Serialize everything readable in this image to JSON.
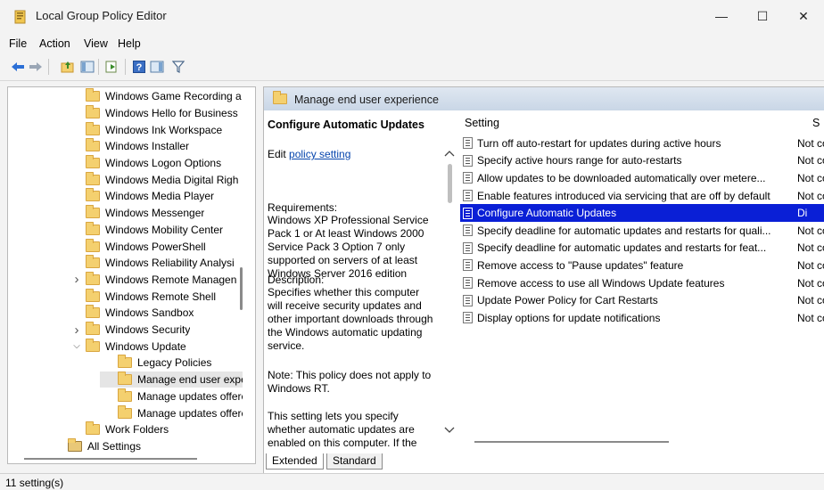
{
  "window": {
    "title": "Local Group Policy Editor",
    "minimize_glyph": "—",
    "maximize_glyph": "☐",
    "close_glyph": "✕"
  },
  "menu": [
    "File",
    "Action",
    "View",
    "Help"
  ],
  "toolbar": {
    "icons": [
      "back-arrow-icon",
      "forward-arrow-icon",
      "up-folder-icon",
      "show-hide-tree-icon",
      "export-list-icon",
      "help-icon",
      "show-hide-action-pane-icon",
      "filter-icon"
    ]
  },
  "tree": {
    "items": [
      {
        "label": "Windows Game Recording a",
        "indent": 1,
        "expander": ""
      },
      {
        "label": "Windows Hello for Business",
        "indent": 1,
        "expander": ""
      },
      {
        "label": "Windows Ink Workspace",
        "indent": 1,
        "expander": ""
      },
      {
        "label": "Windows Installer",
        "indent": 1,
        "expander": ""
      },
      {
        "label": "Windows Logon Options",
        "indent": 1,
        "expander": ""
      },
      {
        "label": "Windows Media Digital Righ",
        "indent": 1,
        "expander": ""
      },
      {
        "label": "Windows Media Player",
        "indent": 1,
        "expander": ""
      },
      {
        "label": "Windows Messenger",
        "indent": 1,
        "expander": ""
      },
      {
        "label": "Windows Mobility Center",
        "indent": 1,
        "expander": ""
      },
      {
        "label": "Windows PowerShell",
        "indent": 1,
        "expander": ""
      },
      {
        "label": "Windows Reliability Analysi",
        "indent": 1,
        "expander": ""
      },
      {
        "label": "Windows Remote Managen",
        "indent": 1,
        "expander": ">"
      },
      {
        "label": "Windows Remote Shell",
        "indent": 1,
        "expander": ""
      },
      {
        "label": "Windows Sandbox",
        "indent": 1,
        "expander": ""
      },
      {
        "label": "Windows Security",
        "indent": 1,
        "expander": ">"
      },
      {
        "label": "Windows Update",
        "indent": 1,
        "expander": "v"
      },
      {
        "label": "Legacy Policies",
        "indent": 2,
        "expander": ""
      },
      {
        "label": "Manage end user experi",
        "indent": 2,
        "expander": "",
        "selected": true
      },
      {
        "label": "Manage updates offerec",
        "indent": 2,
        "expander": ""
      },
      {
        "label": "Manage updates offerec",
        "indent": 2,
        "expander": ""
      },
      {
        "label": "Work Folders",
        "indent": 1,
        "expander": ""
      },
      {
        "label": "All Settings",
        "indent": 0,
        "expander": "",
        "special_icon": true
      }
    ]
  },
  "right_pane": {
    "header": "Manage end user experience",
    "description": {
      "title": "Configure Automatic Updates",
      "edit_prefix": "Edit ",
      "edit_link": "policy setting ",
      "requirements_label": "Requirements:",
      "requirements_text": "Windows XP Professional Service Pack 1 or At least Windows 2000 Service Pack 3 Option 7 only supported on servers of at least Windows Server 2016 edition",
      "description_label": "Description:",
      "description_text": "Specifies whether this computer will receive security updates and other important downloads through the Windows automatic updating service.",
      "note_text": "Note: This policy does not apply to Windows RT.",
      "more_text": "This setting lets you specify whether automatic updates are enabled on this computer. If the"
    },
    "columns": {
      "setting": "Setting",
      "state": "S"
    },
    "settings": [
      {
        "name": "Turn off auto-restart for updates during active hours",
        "state": "Not co"
      },
      {
        "name": "Specify active hours range for auto-restarts",
        "state": "Not co"
      },
      {
        "name": "Allow updates to be downloaded automatically over metere...",
        "state": "Not co"
      },
      {
        "name": "Enable features introduced via servicing that are off by default",
        "state": "Not co"
      },
      {
        "name": "Configure Automatic Updates",
        "state": "Di",
        "selected": true
      },
      {
        "name": "Specify deadline for automatic updates and restarts for quali...",
        "state": "Not co"
      },
      {
        "name": "Specify deadline for automatic updates and restarts for feat...",
        "state": "Not co"
      },
      {
        "name": "Remove access to \"Pause updates\" feature",
        "state": "Not co"
      },
      {
        "name": "Remove access to use all Windows Update features",
        "state": "Not co"
      },
      {
        "name": "Update Power Policy for Cart Restarts",
        "state": "Not co"
      },
      {
        "name": "Display options for update notifications",
        "state": "Not co"
      }
    ],
    "tabs": [
      "Extended",
      "Standard"
    ]
  },
  "status": {
    "text": "11 setting(s)"
  },
  "colors": {
    "selection": "#0a1fd6",
    "header_gradient_top": "#dfe7f1",
    "header_gradient_bottom": "#c9d6e6",
    "link": "#0645ad",
    "folder": "#f4d06f"
  }
}
